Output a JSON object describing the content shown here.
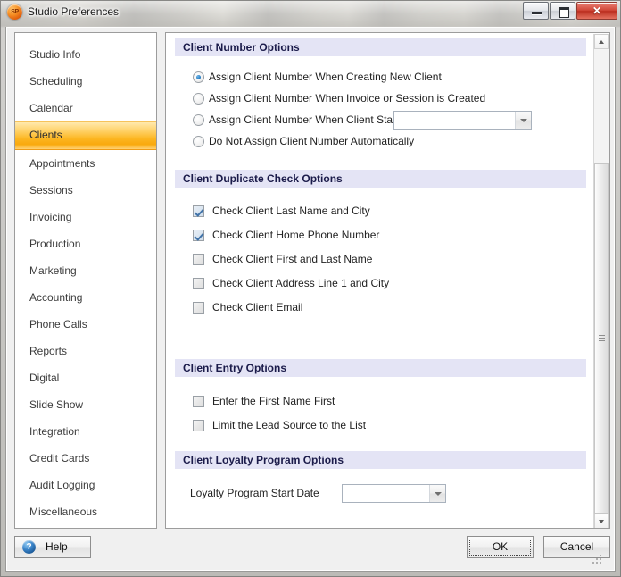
{
  "window": {
    "title": "Studio Preferences",
    "app_icon_text": "SP",
    "minimize_label": "Minimize",
    "maximize_label": "Maximize",
    "close_label": "✕"
  },
  "sidebar": {
    "items": [
      {
        "label": "Studio Info",
        "selected": false
      },
      {
        "label": "Scheduling",
        "selected": false
      },
      {
        "label": "Calendar",
        "selected": false
      },
      {
        "label": "Clients",
        "selected": true
      },
      {
        "label": "Appointments",
        "selected": false
      },
      {
        "label": "Sessions",
        "selected": false
      },
      {
        "label": "Invoicing",
        "selected": false
      },
      {
        "label": "Production",
        "selected": false
      },
      {
        "label": "Marketing",
        "selected": false
      },
      {
        "label": "Accounting",
        "selected": false
      },
      {
        "label": "Phone Calls",
        "selected": false
      },
      {
        "label": "Reports",
        "selected": false
      },
      {
        "label": "Digital",
        "selected": false
      },
      {
        "label": "Slide Show",
        "selected": false
      },
      {
        "label": "Integration",
        "selected": false
      },
      {
        "label": "Credit Cards",
        "selected": false
      },
      {
        "label": "Audit Logging",
        "selected": false
      },
      {
        "label": "Miscellaneous",
        "selected": false
      }
    ],
    "selected_accent": "#f9a90d"
  },
  "content": {
    "client_number_options": {
      "header": "Client Number Options",
      "radios": [
        {
          "label": "Assign Client Number When Creating New Client",
          "checked": true
        },
        {
          "label": "Assign Client Number When Invoice or Session is Created",
          "checked": false
        },
        {
          "label": "Assign Client Number When Client Status is",
          "checked": false
        },
        {
          "label": "Do Not Assign Client Number Automatically",
          "checked": false
        }
      ],
      "status_combo_value": ""
    },
    "client_duplicate_check_options": {
      "header": "Client Duplicate Check Options",
      "checkboxes": [
        {
          "label": "Check Client Last Name and City",
          "checked": true
        },
        {
          "label": "Check Client Home Phone Number",
          "checked": true
        },
        {
          "label": "Check Client First and Last Name",
          "checked": false
        },
        {
          "label": "Check Client Address Line 1 and City",
          "checked": false
        },
        {
          "label": "Check Client Email",
          "checked": false
        }
      ]
    },
    "client_entry_options": {
      "header": "Client Entry Options",
      "checkboxes": [
        {
          "label": "Enter the First Name First",
          "checked": false
        },
        {
          "label": "Limit the Lead Source to the List",
          "checked": false
        }
      ]
    },
    "client_loyalty_program_options": {
      "header": "Client Loyalty Program Options",
      "start_date_label": "Loyalty Program Start Date",
      "start_date_value": ""
    }
  },
  "footer": {
    "help_label": "Help",
    "help_icon_glyph": "?",
    "ok_label": "OK",
    "cancel_label": "Cancel"
  }
}
